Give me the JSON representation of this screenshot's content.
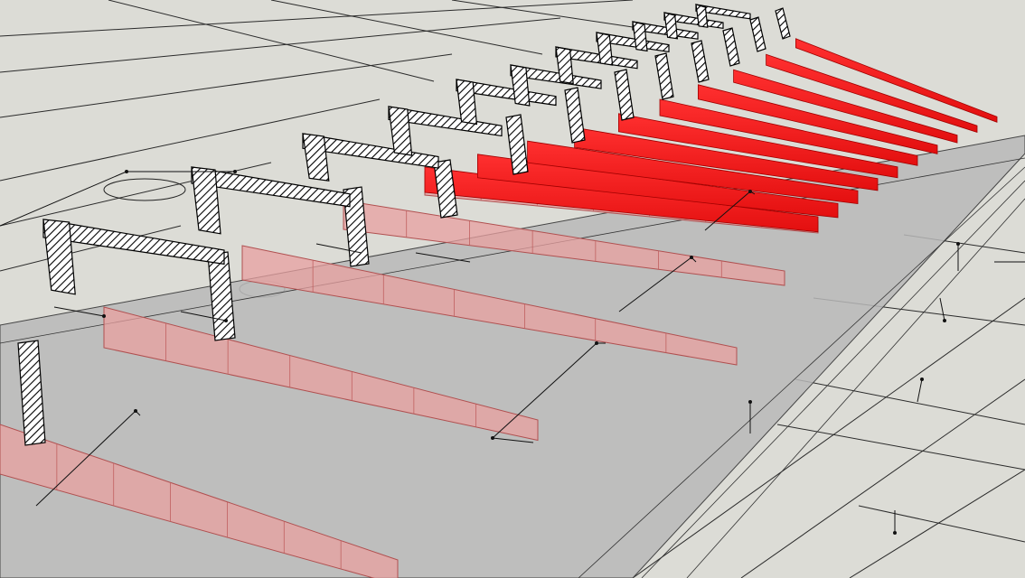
{
  "viewport": {
    "projection": "perspective",
    "display_mode": "wireframe-shaded"
  },
  "colors": {
    "ground": "#dcdcd6",
    "slab_shade": "#b9b9b9",
    "wire": "#1a1a1a",
    "beam_highlight": "#ff1a1a",
    "beam_ghost": "#e8a0a0",
    "hatch": "#000000"
  },
  "scene": {
    "frames": 12,
    "beams_highlighted": 10,
    "beams_ghosted": 5
  }
}
